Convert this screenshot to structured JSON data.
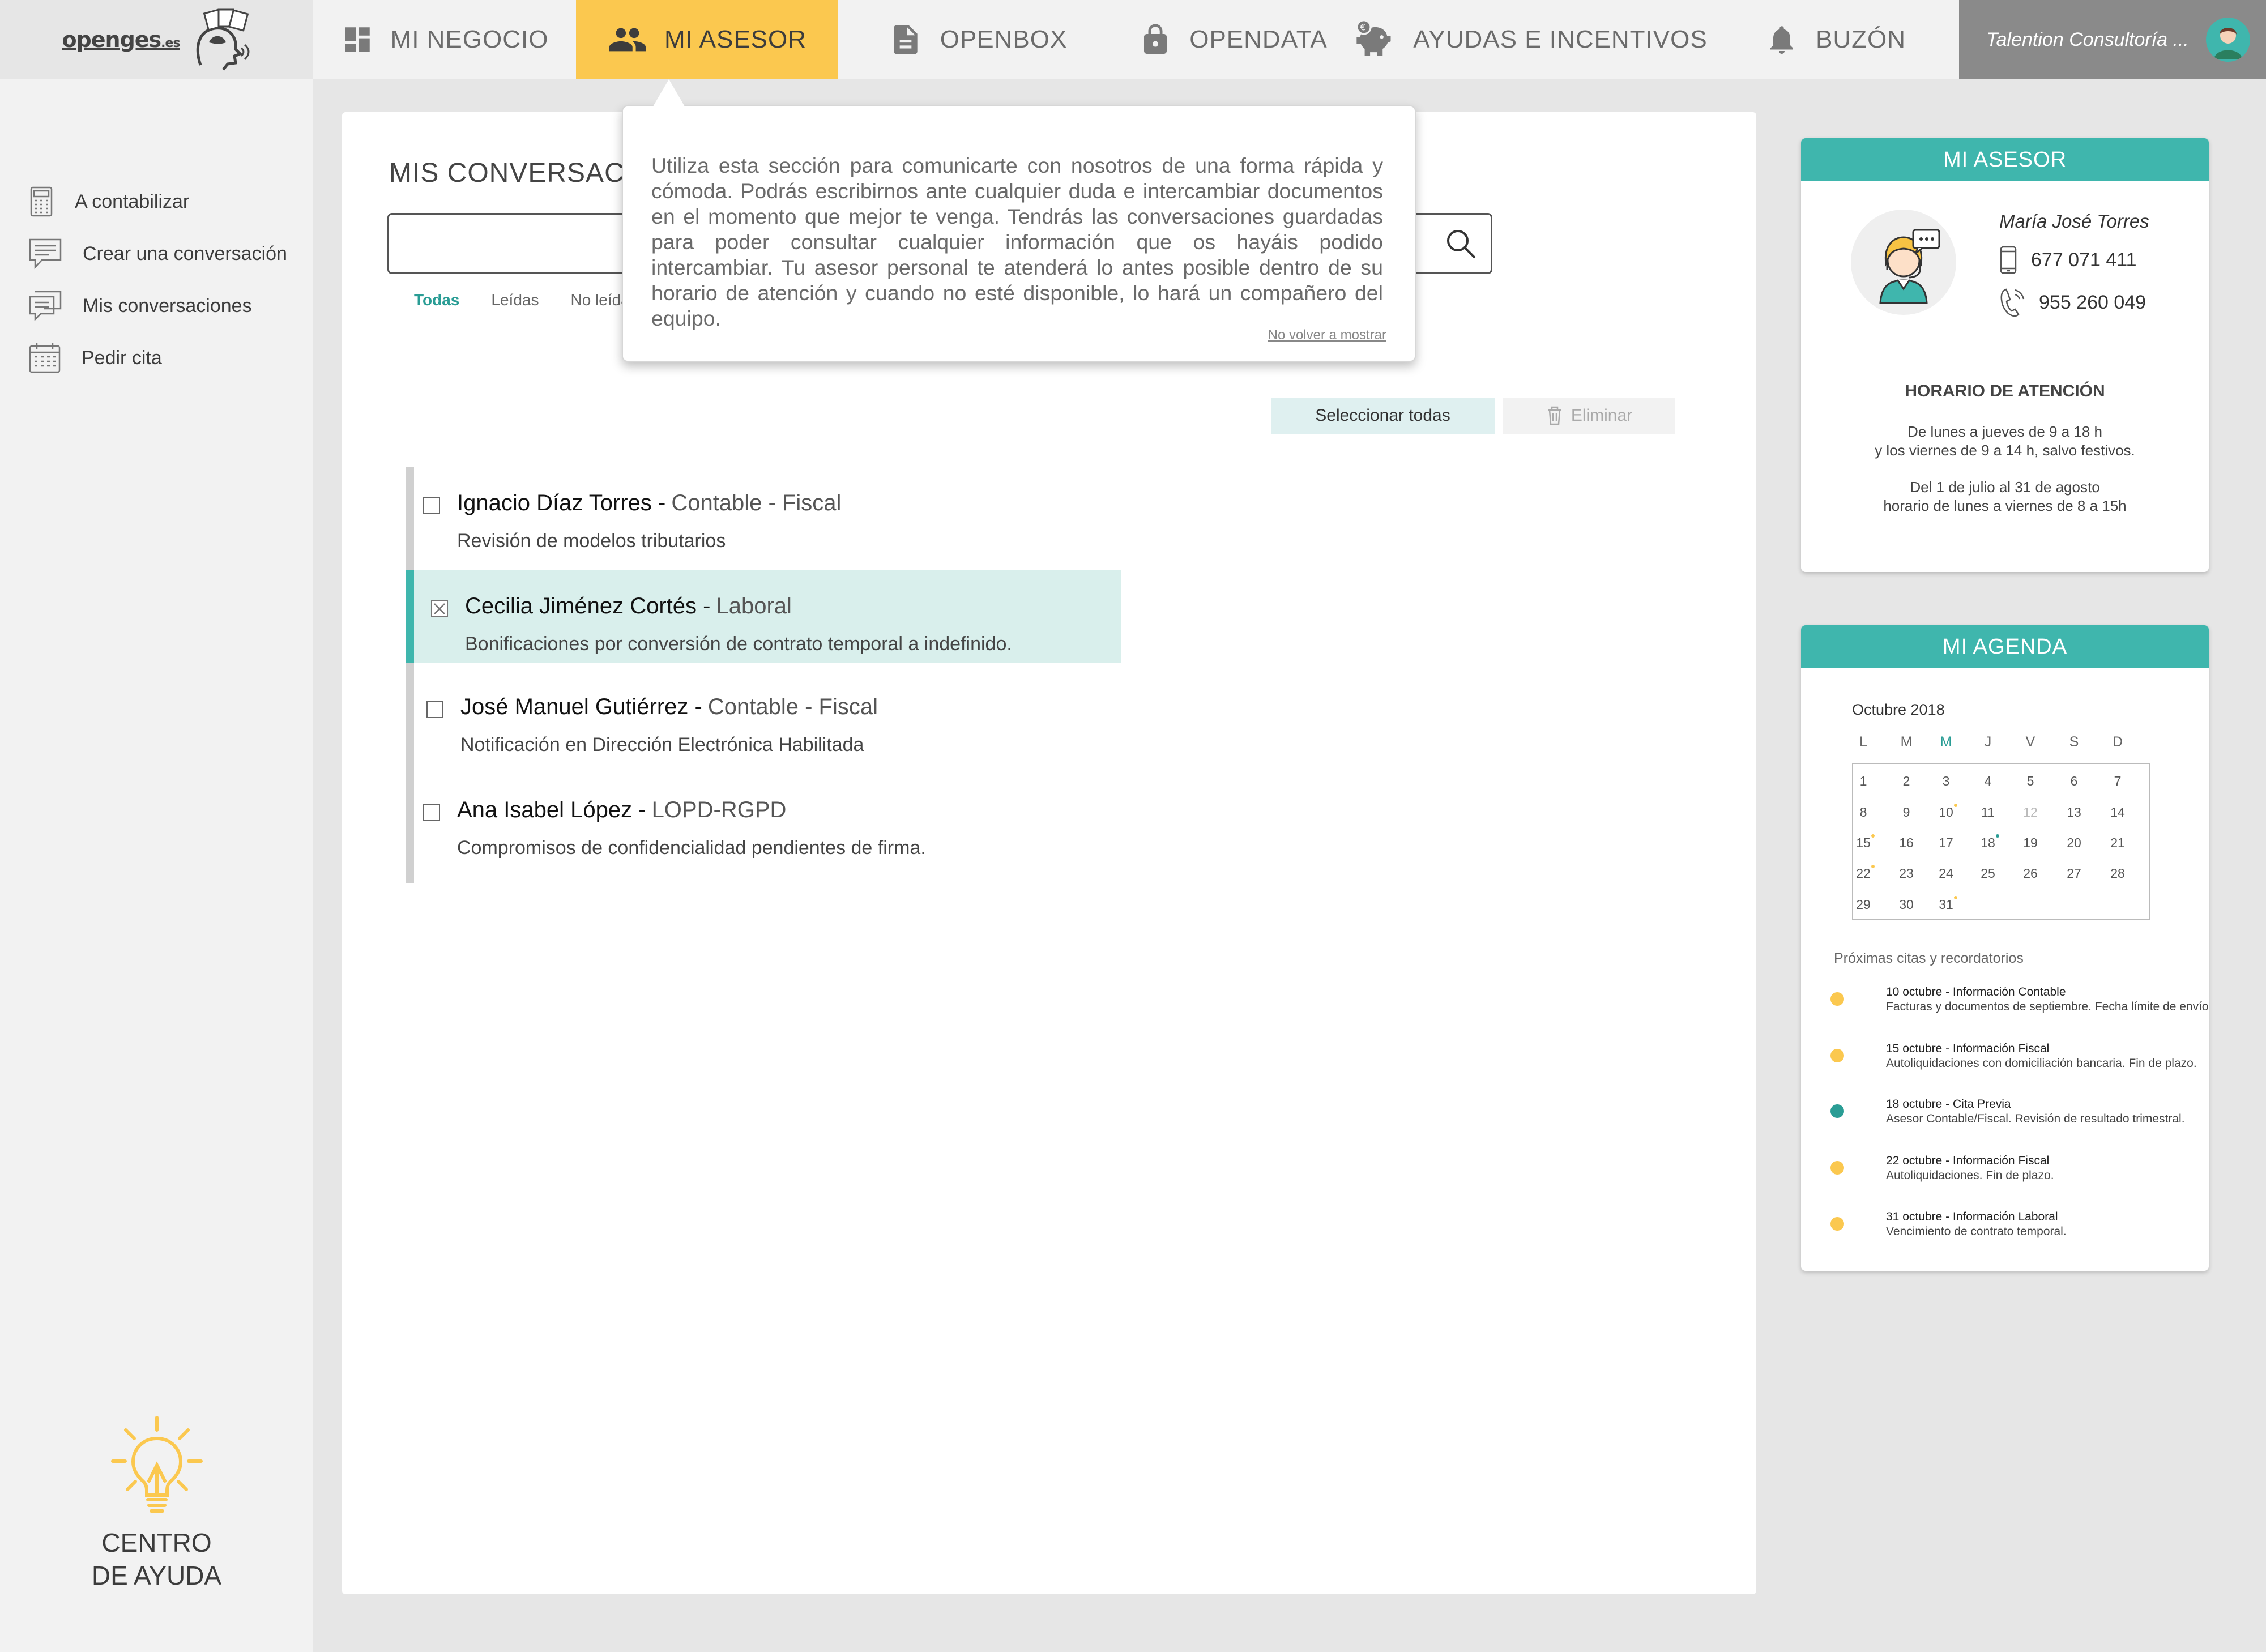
{
  "nav": {
    "logo": {
      "main": "openges",
      "suffix": ".es"
    },
    "items": [
      {
        "label": "MI NEGOCIO",
        "icon": "dashboard-icon"
      },
      {
        "label": "MI ASESOR",
        "icon": "people-icon",
        "active": true
      },
      {
        "label": "OPENBOX",
        "icon": "document-icon"
      },
      {
        "label": "OPENDATA",
        "icon": "lock-icon"
      },
      {
        "label": "AYUDAS E INCENTIVOS",
        "icon": "piggy-bank-icon"
      },
      {
        "label": "BUZÓN",
        "icon": "bell-icon"
      }
    ],
    "user": "Talention Consultoría ...",
    "colors": {
      "active_bg": "#fbc84f",
      "user_bg": "#8a8a8a"
    }
  },
  "sidebar": {
    "items": [
      {
        "label": "A contabilizar",
        "icon": "calculator-icon"
      },
      {
        "label": "Crear una conversación",
        "icon": "chat-new-icon"
      },
      {
        "label": "Mis conversaciones",
        "icon": "chat-list-icon"
      },
      {
        "label": "Pedir cita",
        "icon": "calendar-icon"
      }
    ],
    "help": {
      "line1": "CENTRO",
      "line2": "DE AYUDA",
      "icon": "lightbulb-icon",
      "color": "#fbc84f"
    }
  },
  "main": {
    "title": "MIS CONVERSACIONES",
    "search": {
      "value": "",
      "placeholder": ""
    },
    "filters": [
      {
        "label": "Todas",
        "active": true
      },
      {
        "label": "Leídas"
      },
      {
        "label": "No leídas"
      }
    ],
    "buttons": {
      "select_all": "Seleccionar todas",
      "delete": "Eliminar"
    },
    "conversations": [
      {
        "name": "Ignacio Díaz Torres -",
        "category": "Contable - Fiscal",
        "subject": "Revisión de modelos tributarios",
        "selected": false
      },
      {
        "name": "Cecilia Jiménez Cortés -",
        "category": "Laboral",
        "subject": "Bonificaciones por conversión de contrato temporal a indefinido.",
        "selected": true
      },
      {
        "name": "José Manuel Gutiérrez -",
        "category": "Contable - Fiscal",
        "subject": "Notificación en Dirección Electrónica Habilitada",
        "selected": false
      },
      {
        "name": "Ana Isabel López -",
        "category": "LOPD-RGPD",
        "subject": "Compromisos de confidencialidad pendientes de firma.",
        "selected": false
      }
    ]
  },
  "tooltip": {
    "text": "Utiliza esta sección para comunicarte con nosotros de una forma rápida y cómoda. Podrás escribirnos ante cualquier duda e intercambiar documentos en el momento que mejor te venga. Tendrás las conversaciones guardadas para poder consultar cualquier información que os hayáis podido intercambiar. Tu asesor personal te atenderá lo antes posible dentro de su horario de atención y cuando no esté disponible, lo hará un compañero del equipo.",
    "dismiss": "No volver a mostrar"
  },
  "advisor": {
    "header": "MI ASESOR",
    "name": "María José Torres",
    "mobile": "677 071 411",
    "phone": "955 260 049",
    "hours_title": "HORARIO DE ATENCIÓN",
    "hours_1a": "De lunes a jueves de 9 a 18 h",
    "hours_1b": "y los viernes de 9 a 14 h, salvo festivos.",
    "hours_2a": "Del 1 de julio al 31 de agosto",
    "hours_2b": "horario de lunes a viernes de 8 a 15h",
    "accent": "#3fb6ad"
  },
  "agenda": {
    "header": "MI AGENDA",
    "month": "Octubre 2018",
    "weekdays": [
      "L",
      "M",
      "M",
      "J",
      "V",
      "S",
      "D"
    ],
    "today_weekday_index": 2,
    "days": [
      [
        1,
        2,
        3,
        4,
        5,
        6,
        7
      ],
      [
        8,
        9,
        10,
        11,
        12,
        13,
        14
      ],
      [
        15,
        16,
        17,
        18,
        19,
        20,
        21
      ],
      [
        22,
        23,
        24,
        25,
        26,
        27,
        28
      ],
      [
        29,
        30,
        31
      ]
    ],
    "muted_day": 12,
    "marked_days": {
      "10": "#fbc84f",
      "15": "#fbc84f",
      "18": "#2a9d95",
      "22": "#fbc84f",
      "31": "#fbc84f"
    },
    "upcoming_title": "Próximas citas y recordatorios",
    "events": [
      {
        "title": "10 octubre - Información Contable",
        "desc": "Facturas y documentos de septiembre. Fecha límite de envío.",
        "color": "#fbc84f"
      },
      {
        "title": "15 octubre - Información Fiscal",
        "desc": "Autoliquidaciones con domiciliación bancaria. Fin de plazo.",
        "color": "#fbc84f"
      },
      {
        "title": "18 octubre - Cita Previa",
        "desc": "Asesor Contable/Fiscal. Revisión de resultado trimestral.",
        "color": "#2a9d95"
      },
      {
        "title": "22 octubre - Información Fiscal",
        "desc": "Autoliquidaciones. Fin de plazo.",
        "color": "#fbc84f"
      },
      {
        "title": "31 octubre - Información Laboral",
        "desc": "Vencimiento de contrato temporal.",
        "color": "#fbc84f"
      }
    ]
  }
}
